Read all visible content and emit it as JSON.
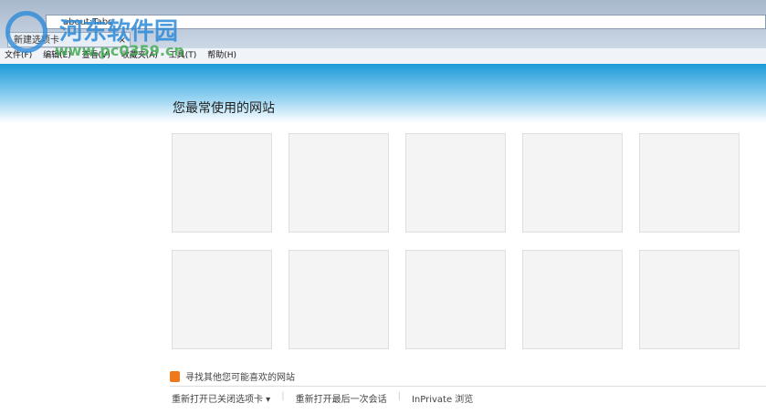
{
  "browser": {
    "address": "about:Tabs",
    "tab_title": "新建选项卡",
    "tab_close": "×"
  },
  "menu": [
    "文件(F)",
    "编辑(E)",
    "查看(V)",
    "收藏夹(A)",
    "工具(T)",
    "帮助(H)"
  ],
  "main": {
    "title": "您最常使用的网站",
    "find_link": "寻找其他您可能喜欢的网站",
    "links": [
      "重新打开已关闭选项卡 ▾",
      "重新打开最后一次会话",
      "InPrivate 浏览"
    ],
    "separator": "|"
  },
  "watermark": {
    "name": "河东软件园",
    "url": "www.pc0359.cn"
  }
}
